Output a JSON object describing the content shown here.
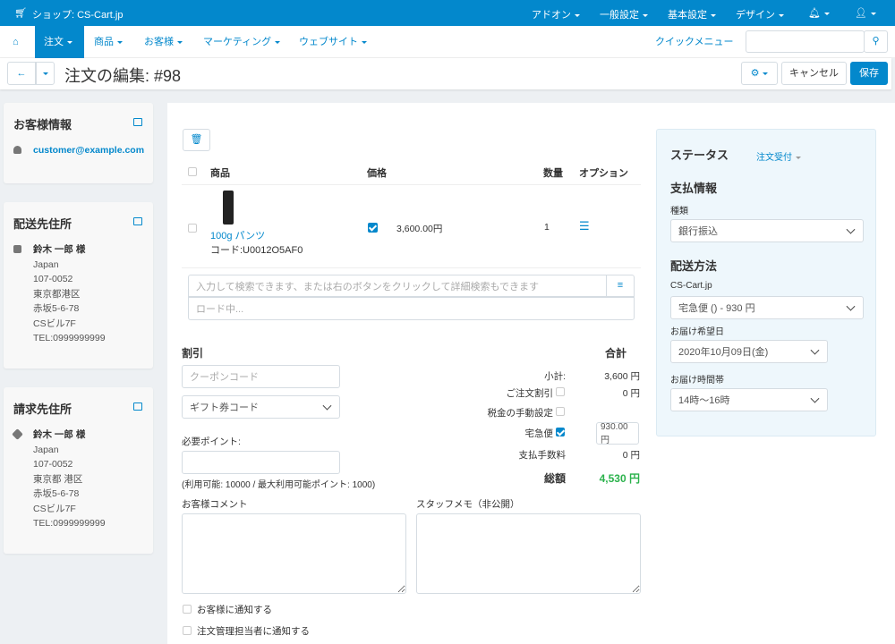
{
  "topbar": {
    "shop": "ショップ: CS-Cart.jp",
    "menus": [
      "アドオン",
      "一般設定",
      "基本設定",
      "デザイン"
    ]
  },
  "nav": {
    "items": [
      "注文",
      "商品",
      "お客様",
      "マーケティング",
      "ウェブサイト"
    ],
    "quick_menu": "クイックメニュー",
    "search_placeholder": ""
  },
  "toolbar": {
    "title": "注文の編集: #98",
    "cancel": "キャンセル",
    "save": "保存"
  },
  "customer": {
    "title": "お客様情報",
    "email": "customer@example.com"
  },
  "shipping": {
    "title": "配送先住所",
    "name": "鈴木 一郎 様",
    "lines": [
      "Japan",
      "107-0052",
      "東京都港区",
      "赤坂5-6-78",
      "CSビル7F",
      "TEL:0999999999"
    ]
  },
  "billing": {
    "title": "請求先住所",
    "name": "鈴木 一郎 様",
    "lines": [
      "Japan",
      "107-0052",
      "東京都 港区",
      "赤坂5-6-78",
      "CSビル7F",
      "TEL:0999999999"
    ]
  },
  "products": {
    "headers": [
      "商品",
      "価格",
      "数量",
      "オプション"
    ],
    "rows": [
      {
        "name": "100g パンツ",
        "code": "コード:U0012O5AF0",
        "price": "3,600.00円",
        "qty": "1",
        "price_checked": true
      }
    ],
    "search_placeholder": "入力して検索できます、または右のボタンをクリックして詳細検索もできます",
    "loading": "ロード中..."
  },
  "discount": {
    "title": "割引",
    "coupon_placeholder": "クーポンコード",
    "gift": "ギフト券コード",
    "points_label": "必要ポイント:",
    "points_note": "(利用可能: 10000 / 最大利用可能ポイント: 1000)"
  },
  "totals": {
    "title": "合計",
    "subtotal_label": "小計:",
    "subtotal": "3,600 円",
    "order_discount_label": "ご注文割引",
    "order_discount": "0 円",
    "tax_label": "税金の手動設定",
    "shipping_label": "宅急便",
    "shipping_value": "930.00円",
    "fee_label": "支払手数料",
    "fee": "0 円",
    "total_label": "総額",
    "total": "4,530 円",
    "total_color": "#2bb24c"
  },
  "comments": {
    "customer": "お客様コメント",
    "staff": "スタッフメモ（非公開）",
    "notify_customer": "お客様に通知する",
    "notify_manager": "注文管理担当者に通知する"
  },
  "status": {
    "title": "ステータス",
    "value": "注文受付",
    "payment_title": "支払情報",
    "type_label": "種類",
    "payment": "銀行振込",
    "shipping_title": "配送方法",
    "carrier": "CS-Cart.jp",
    "method": "宅急便 () - 930 円",
    "date_label": "お届け希望日",
    "date": "2020年10月09日(金)",
    "time_label": "お届け時間帯",
    "time": "14時～16時"
  },
  "colors": {
    "brand": "#0388cc"
  }
}
